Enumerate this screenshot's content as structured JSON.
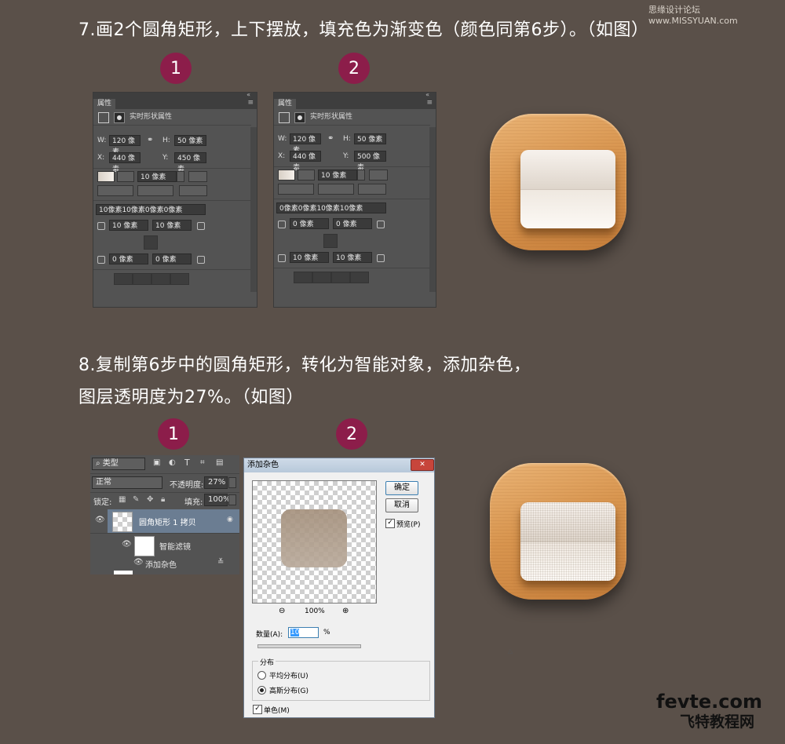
{
  "watermark": "思缘设计论坛 www.MISSYUAN.com",
  "step7": {
    "text": "7.画2个圆角矩形，上下摆放，填充色为渐变色（颜色同第6步）。（如图）",
    "badges": [
      "1",
      "2"
    ],
    "panels": [
      {
        "tab": "属性",
        "heading": "实时形状属性",
        "w_label": "W:",
        "w_value": "120 像素",
        "h_label": "H:",
        "h_value": "50 像素",
        "x_label": "X:",
        "x_value": "440 像素",
        "y_label": "Y:",
        "y_value": "450 像素",
        "stroke_width": "10 像素",
        "corner_summary": "10像素10像素0像素0像素",
        "corner_tl": "10 像素",
        "corner_tr": "10 像素",
        "corner_bl": "0 像素",
        "corner_br": "0 像素"
      },
      {
        "tab": "属性",
        "heading": "实时形状属性",
        "w_label": "W:",
        "w_value": "120 像素",
        "h_label": "H:",
        "h_value": "50 像素",
        "x_label": "X:",
        "x_value": "440 像素",
        "y_label": "Y:",
        "y_value": "500 像素",
        "stroke_width": "10 像素",
        "corner_summary": "0像素0像素10像素10像素",
        "corner_tl": "0 像素",
        "corner_tr": "0 像素",
        "corner_bl": "10 像素",
        "corner_br": "10 像素"
      }
    ]
  },
  "step8": {
    "line1": "8.复制第6步中的圆角矩形，转化为智能对象，添加杂色，",
    "line2": "图层透明度为27%。（如图）",
    "badges": [
      "1",
      "2"
    ],
    "layers": {
      "filter_kind": "类型",
      "blend_mode": "正常",
      "opacity_label": "不透明度:",
      "opacity_value": "27%",
      "lock_label": "锁定:",
      "fill_label": "填充:",
      "fill_value": "100%",
      "layer_name": "圆角矩形 1 拷贝",
      "smart_filters": "智能滤镜",
      "filter_name": "添加杂色"
    },
    "dialog": {
      "title": "添加杂色",
      "ok": "确定",
      "cancel": "取消",
      "preview_label": "预览(P)",
      "preview_checked": true,
      "zoom": "100%",
      "amount_label": "数量(A):",
      "amount_value": "10",
      "amount_unit": "%",
      "amount_slider": 0.1,
      "distribution_label": "分布",
      "uniform": "平均分布(U)",
      "gaussian": "高斯分布(G)",
      "selected": "gaussian",
      "mono": "单色(M)",
      "mono_checked": true
    }
  },
  "logo": {
    "line1": "fevte.com",
    "line2": "飞特教程网"
  },
  "colors": {
    "background": "#5a5049",
    "badge": "#8c1d4a",
    "panel": "#535353",
    "wood": "#d8954f"
  }
}
